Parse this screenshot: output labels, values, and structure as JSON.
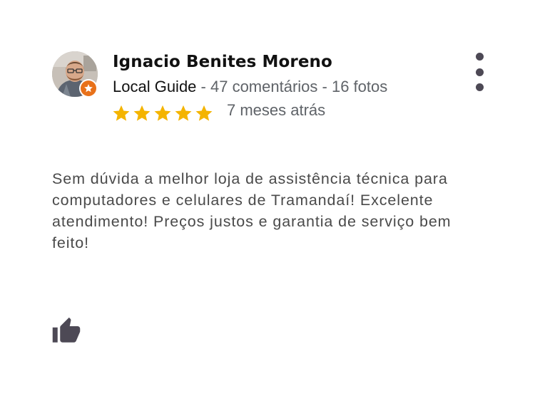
{
  "review": {
    "reviewer": {
      "name": "Ignacio Benites Moreno",
      "is_local_guide": true,
      "local_guide_label": "Local Guide",
      "separator": " - ",
      "reviews_count": "47 comentários",
      "photos_count": "16 fotos"
    },
    "rating": 5,
    "max_rating": 5,
    "date": "7 meses atrás",
    "text": "Sem dúvida a melhor loja de assistência técnica para computadores e celulares de Tramandaí! Excelente atendimento! Preços justos e garantia de serviço bem feito!"
  },
  "icons": {
    "avatar": "avatar",
    "badge": "local-guide-star-icon",
    "star": "star-icon",
    "menu": "more-vertical-icon",
    "like": "thumbs-up-icon"
  },
  "colors": {
    "star": "#F4B400",
    "badge": "#E8711A",
    "menu_dots": "#4D4955",
    "like_icon": "#4D4955",
    "name": "#111111",
    "secondary_text": "#5F6368",
    "body_text": "#4A4A4A"
  }
}
